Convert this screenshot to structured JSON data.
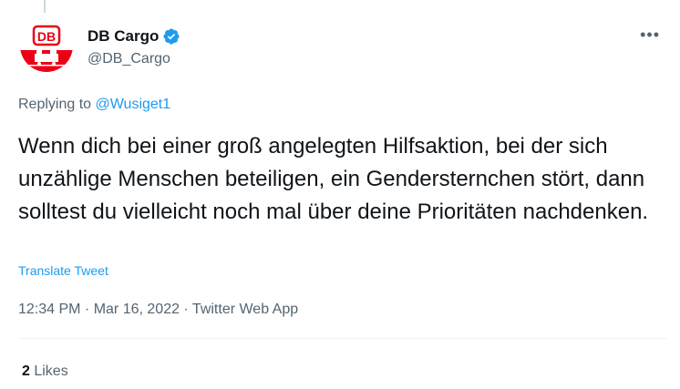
{
  "tweet": {
    "author": {
      "name": "DB Cargo",
      "handle": "@DB_Cargo",
      "verified": true,
      "avatar_logo_text": "DB"
    },
    "reply": {
      "prefix": "Replying to ",
      "target": "@Wusiget1"
    },
    "text": "Wenn dich bei einer groß angelegten Hilfsaktion, bei der sich unzählige Menschen beteiligen, ein Gendersternchen stört, dann solltest du vielleicht noch mal über deine Prioritäten nachdenken.",
    "translate_label": "Translate Tweet",
    "time": "12:34 PM",
    "separator": " · ",
    "date": "Mar 16, 2022",
    "source": "Twitter Web App",
    "likes": {
      "count": "2",
      "label": " Likes"
    },
    "more_icon": "more-horizontal-icon"
  },
  "colors": {
    "accent": "#1d9bf0",
    "brand_red": "#ec0016",
    "text_primary": "#0f1419",
    "text_secondary": "#536471"
  }
}
